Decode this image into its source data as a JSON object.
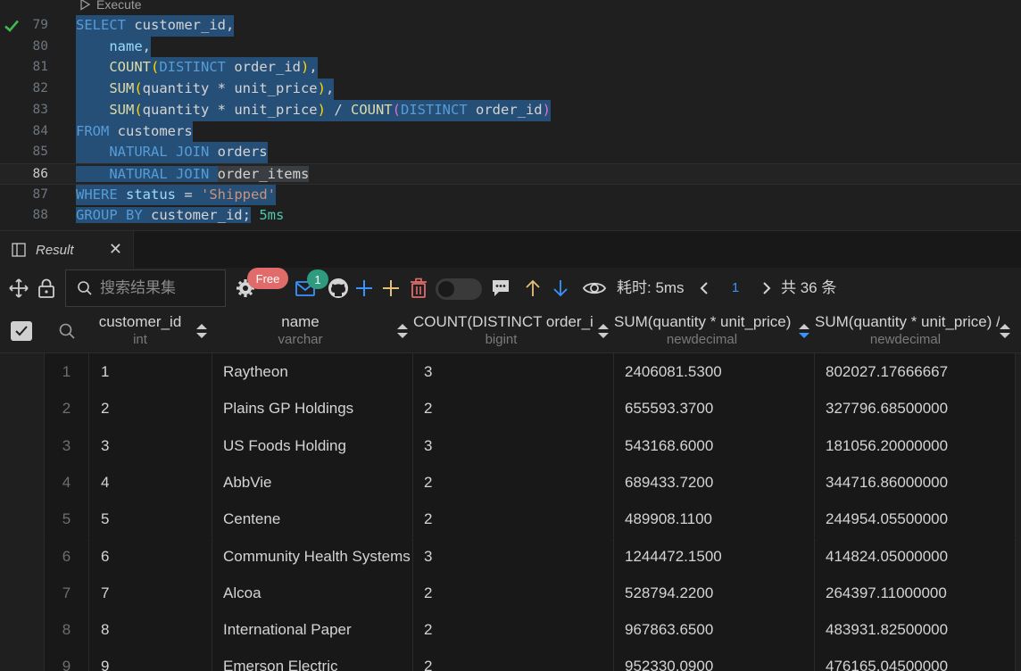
{
  "editor": {
    "codelens_label": "Execute",
    "lines": [
      {
        "num": "79"
      },
      {
        "num": "80"
      },
      {
        "num": "81"
      },
      {
        "num": "82"
      },
      {
        "num": "83"
      },
      {
        "num": "84"
      },
      {
        "num": "85"
      },
      {
        "num": "86"
      },
      {
        "num": "87"
      },
      {
        "num": "88"
      }
    ],
    "code": {
      "l79_kw": "SELECT",
      "l79_rest": " customer_id,",
      "l80": "name",
      "l81_fn": "COUNT",
      "l81_kw": "DISTINCT",
      "l81_id": " order_id",
      "l82_fn": "SUM",
      "l82_id": "quantity * unit_price",
      "l83_fn": "SUM",
      "l83_id": "quantity * unit_price",
      "l83_op": " / ",
      "l83_fn2": "COUNT",
      "l83_kw": "DISTINCT",
      "l83_id2": " order_id",
      "l84_kw": "FROM",
      "l84_rest": " customers",
      "l85_kw": "NATURAL JOIN",
      "l85_rest": " orders",
      "l86_kw": "NATURAL JOIN",
      "l86_rest": "order_items",
      "l87_kw": "WHERE",
      "l87_id": " status",
      "l87_op": " = ",
      "l87_str": "'Shipped'",
      "l88_kw": "GROUP BY",
      "l88_rest": " customer_id;",
      "duration": "5ms"
    }
  },
  "result_tab": {
    "label": "Result",
    "close": "✕"
  },
  "toolbar": {
    "search_placeholder": "搜索结果集",
    "free_badge": "Free",
    "mail_count": "1",
    "timing": "耗时: 5ms",
    "page": "1",
    "total": "共 36 条",
    "accent": "#3794ff"
  },
  "columns": [
    {
      "name": "customer_id",
      "type": "int"
    },
    {
      "name": "name",
      "type": "varchar"
    },
    {
      "name": "COUNT(DISTINCT order_id)",
      "type": "bigint"
    },
    {
      "name": "SUM(quantity * unit_price)",
      "type": "newdecimal"
    },
    {
      "name": "SUM(quantity * unit_price) / COUNT(DISTINCT order_id)",
      "type": "newdecimal"
    }
  ],
  "rows": [
    {
      "idx": "1",
      "c1": "1",
      "c2": "Raytheon",
      "c3": "3",
      "c4": "2406081.5300",
      "c5": "802027.17666667"
    },
    {
      "idx": "2",
      "c1": "2",
      "c2": "Plains GP Holdings",
      "c3": "2",
      "c4": "655593.3700",
      "c5": "327796.68500000"
    },
    {
      "idx": "3",
      "c1": "3",
      "c2": "US Foods Holding",
      "c3": "3",
      "c4": "543168.6000",
      "c5": "181056.20000000"
    },
    {
      "idx": "4",
      "c1": "4",
      "c2": "AbbVie",
      "c3": "2",
      "c4": "689433.7200",
      "c5": "344716.86000000"
    },
    {
      "idx": "5",
      "c1": "5",
      "c2": "Centene",
      "c3": "2",
      "c4": "489908.1100",
      "c5": "244954.05500000"
    },
    {
      "idx": "6",
      "c1": "6",
      "c2": "Community Health Systems",
      "c3": "3",
      "c4": "1244472.1500",
      "c5": "414824.05000000"
    },
    {
      "idx": "7",
      "c1": "7",
      "c2": "Alcoa",
      "c3": "2",
      "c4": "528794.2200",
      "c5": "264397.11000000"
    },
    {
      "idx": "8",
      "c1": "8",
      "c2": "International Paper",
      "c3": "2",
      "c4": "967863.6500",
      "c5": "483931.82500000"
    },
    {
      "idx": "9",
      "c1": "9",
      "c2": "Emerson Electric",
      "c3": "2",
      "c4": "952330.0900",
      "c5": "476165.04500000"
    }
  ]
}
